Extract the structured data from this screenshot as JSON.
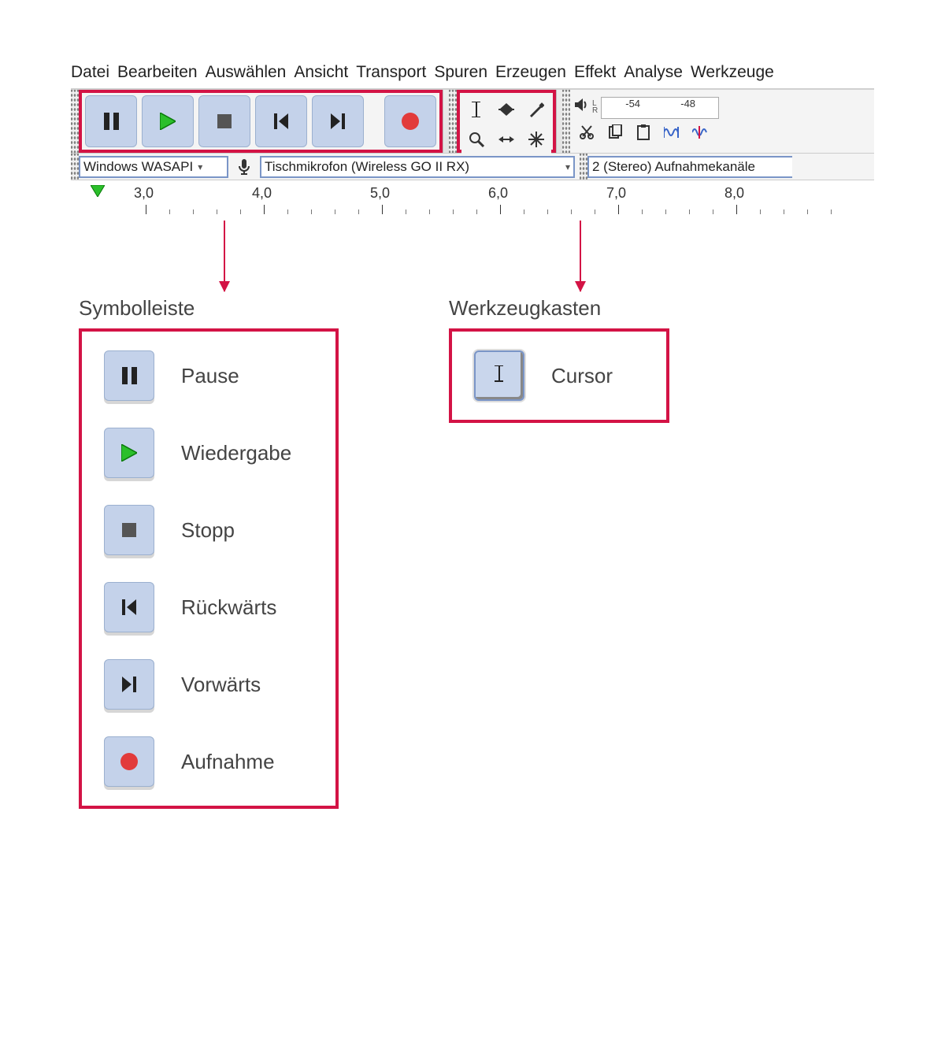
{
  "menu": [
    "Datei",
    "Bearbeiten",
    "Auswählen",
    "Ansicht",
    "Transport",
    "Spuren",
    "Erzeugen",
    "Effekt",
    "Analyse",
    "Werkzeuge"
  ],
  "meter": {
    "L": "L",
    "R": "R",
    "m54": "-54",
    "m48": "-48"
  },
  "device": {
    "host": "Windows WASAPI",
    "input": "Tischmikrofon (Wireless GO II RX)",
    "channels": "2 (Stereo) Aufnahmekanäle"
  },
  "ruler": {
    "v0": "3,0",
    "v1": "4,0",
    "v2": "5,0",
    "v3": "6,0",
    "v4": "7,0",
    "v5": "8,0"
  },
  "legend_transport": {
    "title": "Symbolleiste",
    "pause": "Pause",
    "play": "Wiedergabe",
    "stop": "Stopp",
    "back": "Rückwärts",
    "fwd": "Vorwärts",
    "rec": "Aufnahme"
  },
  "legend_tools": {
    "title": "Werkzeugkasten",
    "cursor": "Cursor"
  }
}
